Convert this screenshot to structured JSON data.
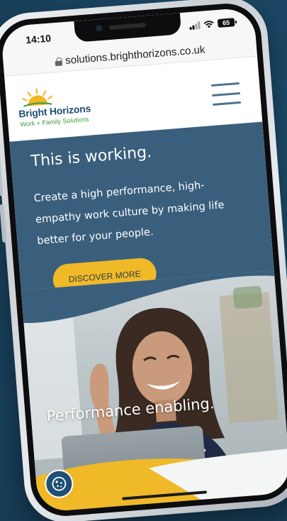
{
  "status_bar": {
    "time": "14:10",
    "battery": "65"
  },
  "browser": {
    "url": "solutions.brighthorizons.co.uk"
  },
  "header": {
    "logo_name": "Bright Horizons",
    "logo_tagline": "Work + Family Solutions"
  },
  "hero": {
    "title": "This is working.",
    "body": "Create a high performance, high-empathy work culture by making life better for your people.",
    "cta_label": "DISCOVER MORE"
  },
  "feature": {
    "overlay_text": "Performance enabling."
  },
  "colors": {
    "brand_navy": "#1f4f74",
    "hero_blue": "#3a5f7c",
    "accent_yellow": "#f0b928",
    "logo_green": "#3d9a3f"
  },
  "icons": [
    "lock-icon",
    "signal-icon",
    "wifi-icon",
    "battery-icon",
    "menu-icon",
    "cookie-icon",
    "sun-logo-icon"
  ]
}
